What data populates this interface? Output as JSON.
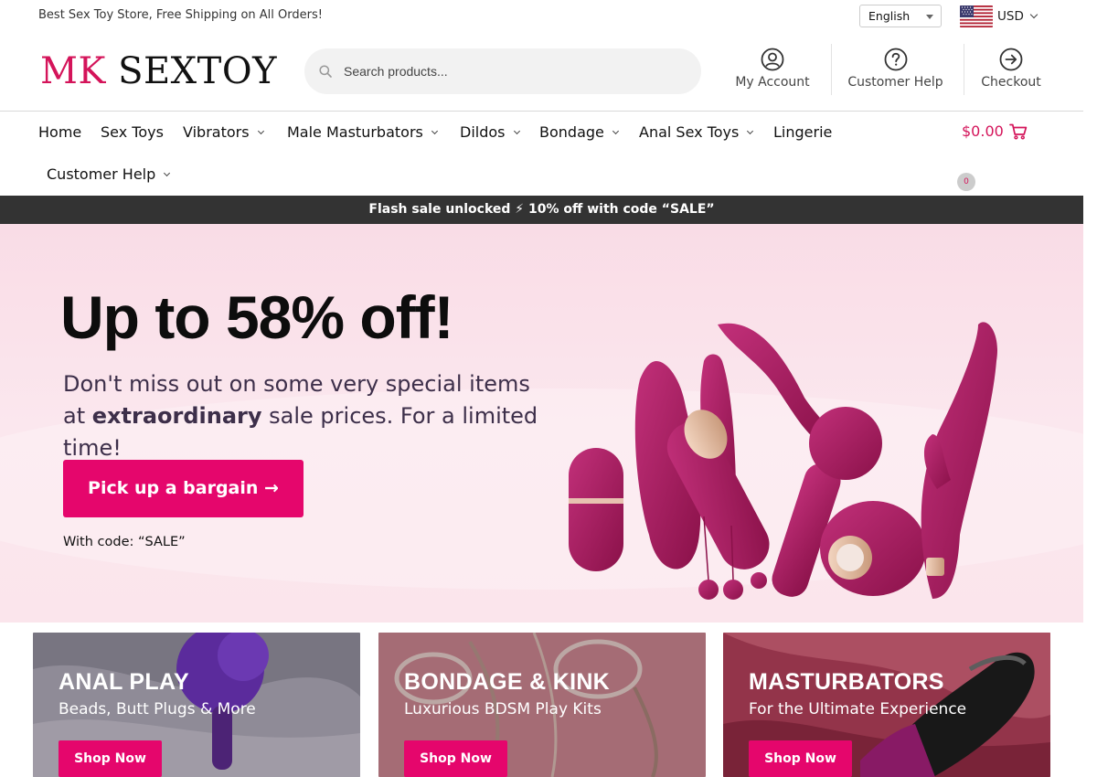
{
  "topbar": {
    "promo": "Best Sex Toy Store, Free Shipping on All Orders!",
    "language": "English",
    "currency": "USD"
  },
  "header": {
    "logo_mk": "MK",
    "logo_rest": "SEXTOY",
    "search_placeholder": "Search products...",
    "links": [
      {
        "label": "My Account",
        "icon": "account-icon"
      },
      {
        "label": "Customer Help",
        "icon": "help-icon"
      },
      {
        "label": "Checkout",
        "icon": "checkout-icon"
      }
    ]
  },
  "nav": {
    "items": [
      {
        "label": "Home"
      },
      {
        "label": "Sex Toys"
      },
      {
        "label": "Vibrators"
      },
      {
        "label": "Male Masturbators"
      },
      {
        "label": "Dildos"
      },
      {
        "label": "Bondage"
      },
      {
        "label": "Anal Sex Toys"
      },
      {
        "label": "Lingerie"
      },
      {
        "label": "Customer Help"
      }
    ],
    "cart_total": "$0.00",
    "cart_count": "0"
  },
  "flash_bar": "Flash sale unlocked ⚡ 10% off with code “SALE”",
  "hero": {
    "title": "Up to 58% off!",
    "sub_before": "Don't miss out on some very special items at ",
    "sub_bold": "extraordinary",
    "sub_after": " sale prices. For a limited time!",
    "button": "Pick up a bargain →",
    "code_note": "With code: “SALE”"
  },
  "categories": [
    {
      "title": "ANAL PLAY",
      "subtitle": "Beads, Butt Plugs & More",
      "button": "Shop Now"
    },
    {
      "title": "BONDAGE & KINK",
      "subtitle": "Luxurious BDSM Play Kits",
      "button": "Shop Now"
    },
    {
      "title": "MASTURBATORS",
      "subtitle": "For the Ultimate Experience",
      "button": "Shop Now"
    }
  ],
  "colors": {
    "brand_pink": "#e5066c",
    "logo_pink": "#d4145a",
    "hero_bg": "#f9dce6",
    "flash_bg": "#333333",
    "product_magenta": "#a3195b"
  }
}
